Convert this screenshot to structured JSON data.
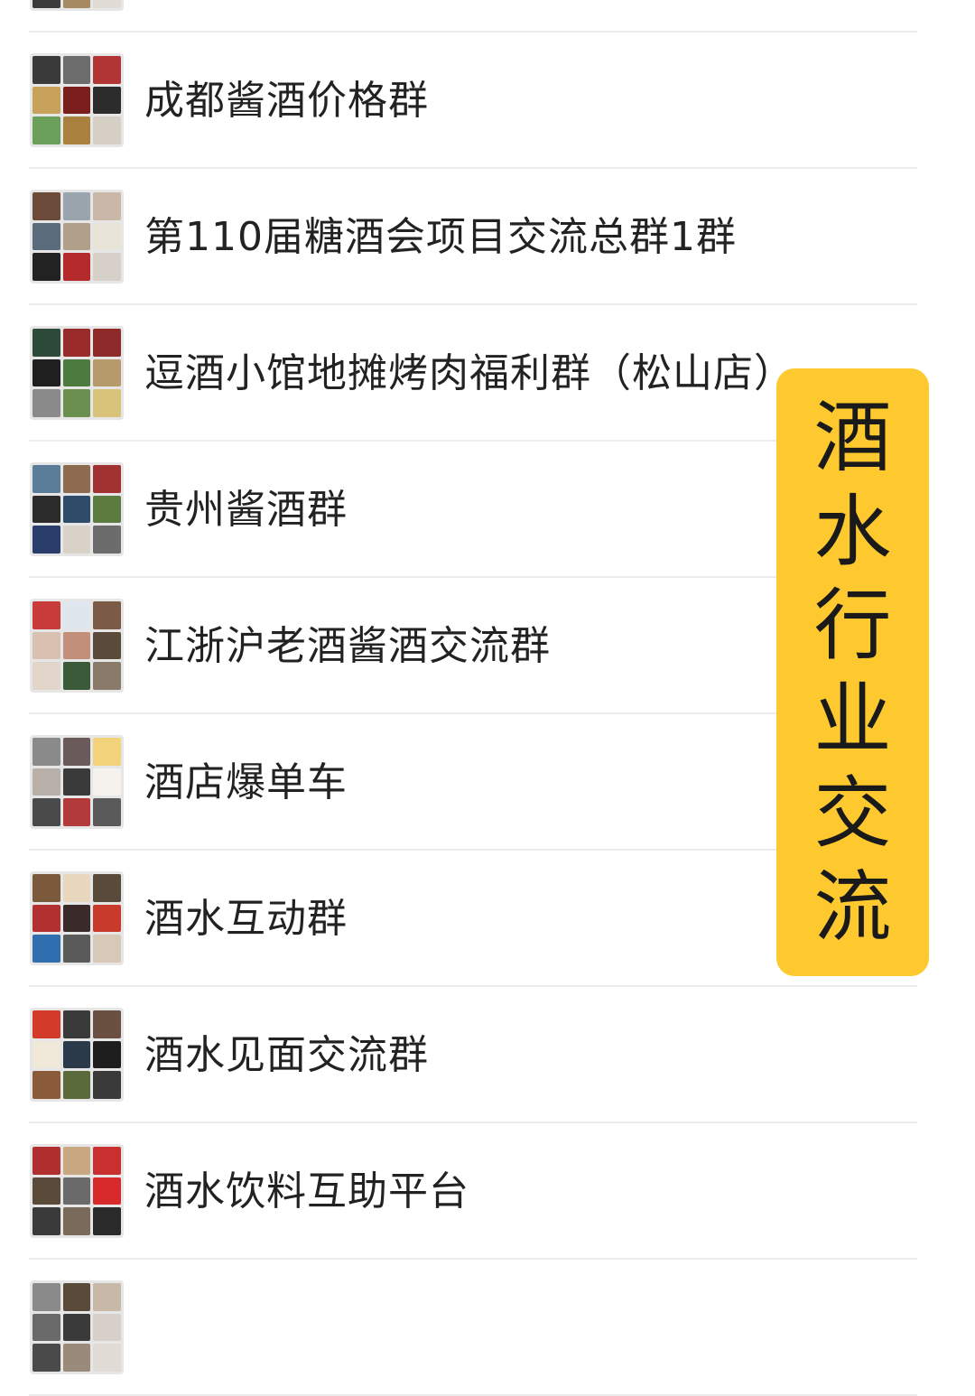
{
  "chat_list": {
    "items": [
      {
        "title": "",
        "avatar_colors": [
          "#4a4a4a",
          "#8b6f4e",
          "#c9c2b8",
          "#2b2b2b",
          "#b33a3a",
          "#d8d0c4",
          "#3b3b3b",
          "#a58a62",
          "#e0dcd5"
        ]
      },
      {
        "title": "成都酱酒价格群",
        "avatar_colors": [
          "#3a3a3a",
          "#6d6d6d",
          "#b23535",
          "#c8a25a",
          "#7a1e1e",
          "#2c2c2c",
          "#6ba05a",
          "#a7813d",
          "#d5cfc6"
        ]
      },
      {
        "title": "第110届糖酒会项目交流总群1群",
        "avatar_colors": [
          "#6c4b3b",
          "#9aa4ad",
          "#c9b7a8",
          "#5a6b7c",
          "#b0a08a",
          "#e9e4da",
          "#222222",
          "#b52b2b",
          "#d7d0c8"
        ]
      },
      {
        "title": "逗酒小馆地摊烤肉福利群（松山店）",
        "avatar_colors": [
          "#2d4a3a",
          "#9a2b2b",
          "#8f2a2a",
          "#1f1f1f",
          "#4d7a3e",
          "#b79a6a",
          "#8a8a8a",
          "#6b8f4f",
          "#d9c27a"
        ]
      },
      {
        "title": "贵州酱酒群",
        "avatar_colors": [
          "#5b7d9a",
          "#8d6b4e",
          "#a23232",
          "#2c2c2c",
          "#2f4b6a",
          "#5d7b3e",
          "#2b3d6a",
          "#d8d2c8",
          "#6c6c6c"
        ]
      },
      {
        "title": "江浙沪老酒酱酒交流群",
        "avatar_colors": [
          "#c93a3a",
          "#dfe6ee",
          "#7b5b48",
          "#d9c1b2",
          "#c28f7a",
          "#5a4a3a",
          "#e2d6cb",
          "#3a5a3a",
          "#8a7a6a"
        ]
      },
      {
        "title": "酒店爆单车",
        "avatar_colors": [
          "#8a8a8a",
          "#6a5a5a",
          "#f2d27a",
          "#b8b0a8",
          "#3a3a3a",
          "#f5f2ee",
          "#4a4a4a",
          "#b23a3a",
          "#5a5a5a"
        ]
      },
      {
        "title": "酒水互动群",
        "avatar_colors": [
          "#7a5a3a",
          "#e8d8c0",
          "#5a4a3a",
          "#b23030",
          "#3a2a2a",
          "#c83a2a",
          "#2f6fb0",
          "#5a5a5a",
          "#d8c8b8"
        ]
      },
      {
        "title": "酒水见面交流群",
        "avatar_colors": [
          "#d43a2a",
          "#3a3a3a",
          "#6a5040",
          "#f0e8d8",
          "#2a3a4a",
          "#1e1e1e",
          "#8a5a3a",
          "#5a6a3a",
          "#3a3a3a"
        ]
      },
      {
        "title": "酒水饮料互助平台",
        "avatar_colors": [
          "#b03030",
          "#c8a880",
          "#c83030",
          "#5a4a3a",
          "#6a6a6a",
          "#d82a2a",
          "#3a3a3a",
          "#7a6a5a",
          "#2a2a2a"
        ]
      },
      {
        "title": "",
        "avatar_colors": [
          "#8a8a8a",
          "#5a4a3a",
          "#c8b8a8",
          "#6a6a6a",
          "#3a3a3a",
          "#d8d0c8",
          "#4a4a4a",
          "#9a8a7a",
          "#e0dcd5"
        ]
      }
    ]
  },
  "badge": {
    "chars": [
      "酒",
      "水",
      "行",
      "业",
      "交",
      "流"
    ]
  }
}
